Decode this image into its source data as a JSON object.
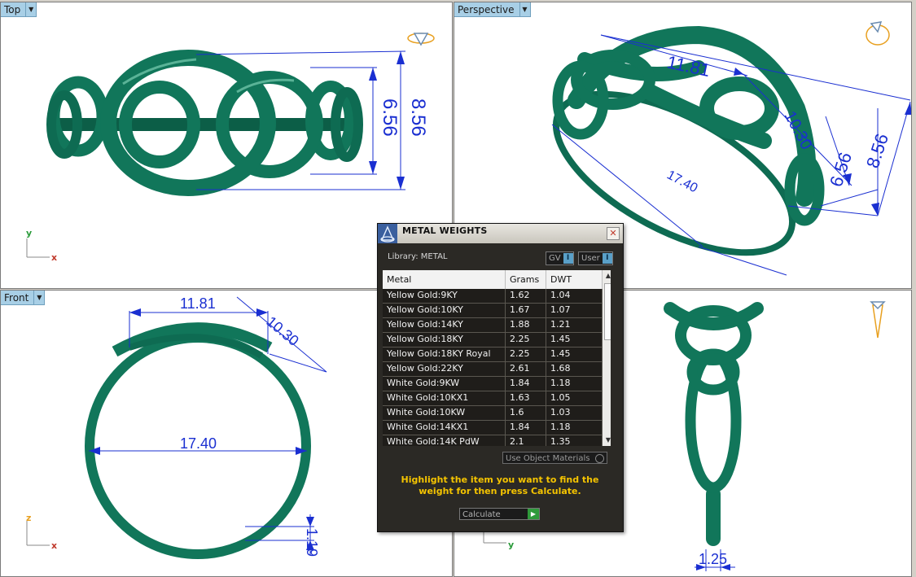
{
  "viewports": {
    "top": {
      "label": "Top"
    },
    "perspective": {
      "label": "Perspective"
    },
    "front": {
      "label": "Front"
    }
  },
  "dimensions": {
    "top_inner": "6.56",
    "top_outer": "8.56",
    "persp_width": "11.81",
    "persp_length": "10.30",
    "persp_dia": "17.40",
    "persp_inner": "6.56",
    "persp_outer": "8.56",
    "front_width": "11.81",
    "front_length": "10.30",
    "front_dia": "17.40",
    "front_thick": "1.19",
    "right_shank": "1.25"
  },
  "axes": {
    "top_y": "y",
    "top_x": "x",
    "front_z": "z",
    "front_x": "x",
    "right_y": "y"
  },
  "panel": {
    "title": "METAL WEIGHTS",
    "close": "✕",
    "library_label": "Library: METAL",
    "toggle_gv": "GV",
    "toggle_user": "User",
    "headers": {
      "metal": "Metal",
      "grams": "Grams",
      "dwt": "DWT"
    },
    "rows": [
      {
        "metal": "Yellow Gold:9KY",
        "grams": "1.62",
        "dwt": "1.04"
      },
      {
        "metal": "Yellow Gold:10KY",
        "grams": "1.67",
        "dwt": "1.07"
      },
      {
        "metal": "Yellow Gold:14KY",
        "grams": "1.88",
        "dwt": "1.21"
      },
      {
        "metal": "Yellow Gold:18KY",
        "grams": "2.25",
        "dwt": "1.45"
      },
      {
        "metal": "Yellow Gold:18KY Royal",
        "grams": "2.25",
        "dwt": "1.45"
      },
      {
        "metal": "Yellow Gold:22KY",
        "grams": "2.61",
        "dwt": "1.68"
      },
      {
        "metal": "White Gold:9KW",
        "grams": "1.84",
        "dwt": "1.18"
      },
      {
        "metal": "White Gold:10KX1",
        "grams": "1.63",
        "dwt": "1.05"
      },
      {
        "metal": "White Gold:10KW",
        "grams": "1.6",
        "dwt": "1.03"
      },
      {
        "metal": "White Gold:14KX1",
        "grams": "1.84",
        "dwt": "1.18"
      },
      {
        "metal": "White Gold:14K PdW",
        "grams": "2.1",
        "dwt": "1.35"
      }
    ],
    "use_object_materials": "Use Object Materials",
    "hint": "Highlight the item you want to find the weight for then press Calculate.",
    "calculate": "Calculate"
  },
  "colors": {
    "ring": "#11765a",
    "dimension": "#1a2fd1",
    "hint": "#f5c400",
    "tab": "#a8cfe6"
  }
}
